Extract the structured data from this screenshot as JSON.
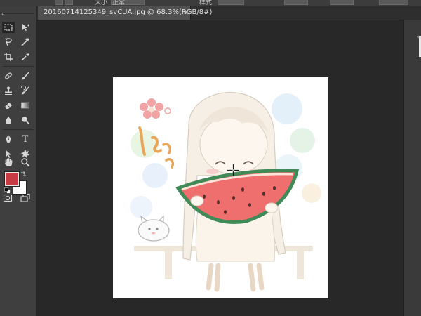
{
  "options_bar": {
    "visible_fragments": [
      "大小",
      "正常",
      "样式"
    ],
    "collapse_arrows": "«"
  },
  "tools": [
    {
      "name": "rectangular-marquee-tool",
      "selected": true
    },
    {
      "name": "move-tool"
    },
    {
      "name": "lasso-tool"
    },
    {
      "name": "magic-wand-tool"
    },
    {
      "name": "crop-tool"
    },
    {
      "name": "eyedropper-tool"
    },
    {
      "name": "healing-brush-tool"
    },
    {
      "name": "brush-tool"
    },
    {
      "name": "clone-stamp-tool"
    },
    {
      "name": "history-brush-tool"
    },
    {
      "name": "eraser-tool"
    },
    {
      "name": "gradient-tool"
    },
    {
      "name": "blur-tool"
    },
    {
      "name": "dodge-tool"
    },
    {
      "name": "pen-tool"
    },
    {
      "name": "type-tool",
      "glyph": "T"
    },
    {
      "name": "path-selection-tool"
    },
    {
      "name": "custom-shape-tool"
    },
    {
      "name": "hand-tool"
    },
    {
      "name": "zoom-tool"
    }
  ],
  "colors": {
    "foreground": "#c73c44",
    "background": "#ffffff",
    "app_bg": "#282828",
    "panel_bg": "#3f3f3f"
  },
  "document_tab": {
    "title": "20160714125349_svCUA.jpg @ 68.3%(RGB/8#)",
    "close_glyph": "×"
  },
  "right_panel": {
    "chevron": "«"
  },
  "canvas": {
    "background": "#ffffff",
    "artwork_text": "しぎっ"
  }
}
